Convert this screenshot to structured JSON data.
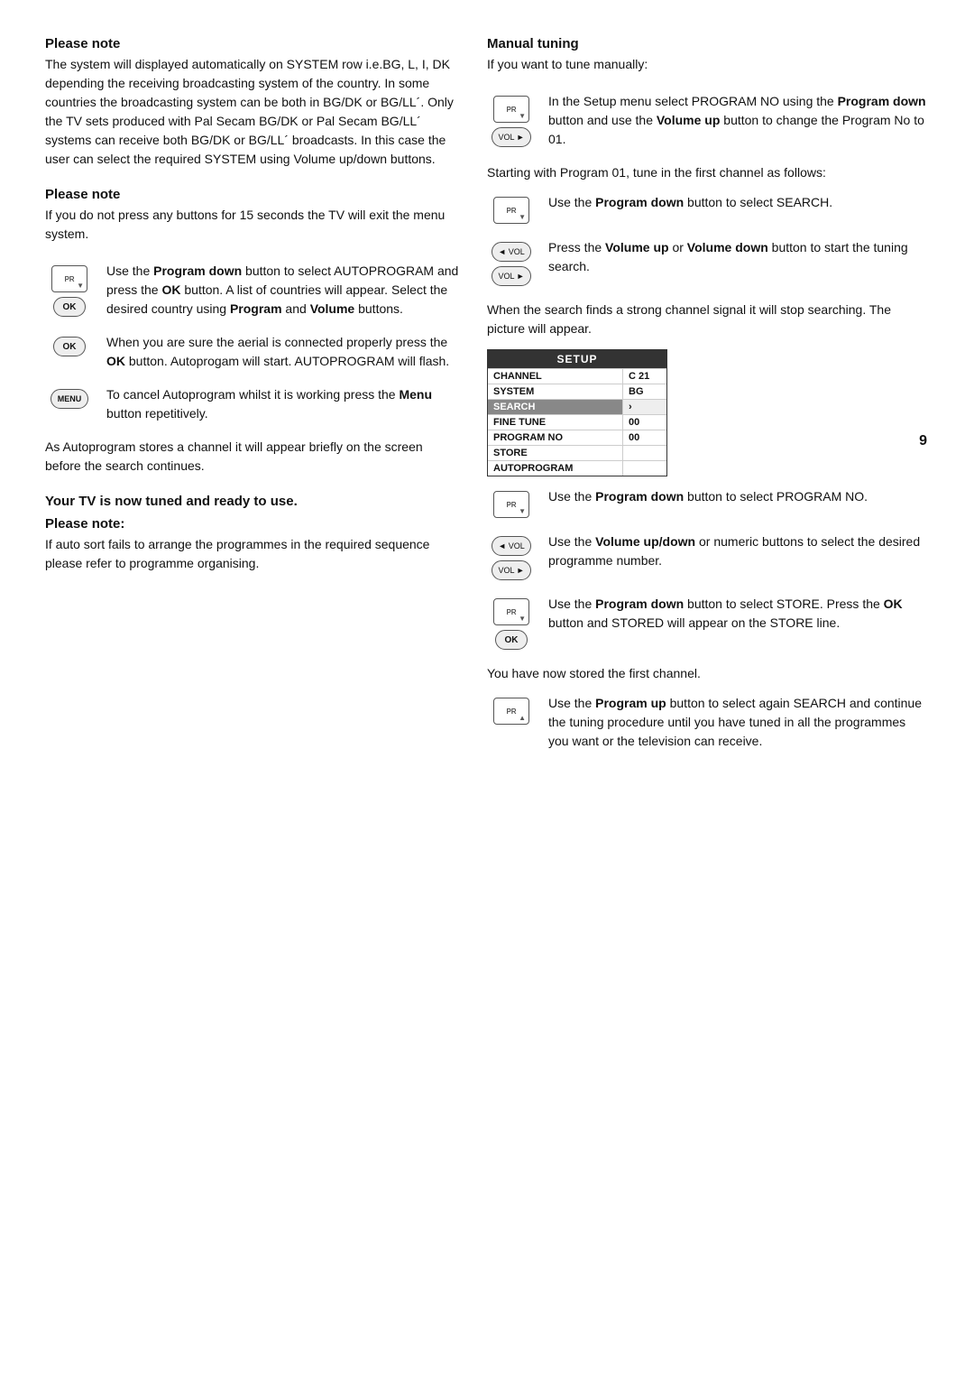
{
  "page": {
    "number": "9"
  },
  "left": {
    "please_note_1_title": "Please note",
    "please_note_1_body": "The system will displayed automatically on SYSTEM row i.e.BG, L, I, DK depending the receiving broadcasting system of the country. In some countries the broadcasting system can be both in BG/DK or BG/LL´. Only the TV sets produced with Pal Secam BG/DK or Pal Secam BG/LL´ systems can receive both BG/DK or BG/LL´ broadcasts. In this case the user can select the required SYSTEM using Volume up/down buttons.",
    "please_note_2_title": "Please note",
    "please_note_2_body": "If you do not press any buttons for 15 seconds the TV will exit the menu system.",
    "icon_row_1_text": "Use the Program down  button to select AUTOPROGRAM and press the OK button.  A list of countries will appear.  Select the desired country using Program and Volume  buttons.",
    "icon_row_2_text": "When you are sure the aerial is connected properly press the  OK button. Autoprogam will start. AUTOPROGRAM will flash.",
    "icon_row_3_text": "To cancel Autoprogram whilst it is working press the Menu button repetitively.",
    "icon_row_4_text": "As Autoprogram stores a channel it will appear briefly on the screen before the search continues.",
    "tuned_text": "Your TV is now tuned and ready to use.",
    "please_note_3_title": "Please note:",
    "please_note_3_body": "If auto sort fails to arrange the programmes in the required sequence please refer to programme organising."
  },
  "right": {
    "manual_tuning_title": "Manual  tuning",
    "manual_tuning_intro": "If you want to tune manually:",
    "block_1_text": "In the Setup menu select PROGRAM NO using the Program down  button and use the Volume up button to change the Program No to 01.",
    "block_2_text": "Starting with Program 01, tune in the first channel as follows:",
    "block_3_text": "Use the Program down  button  to select SEARCH.",
    "block_4_text": "Press the Volume up  or Volume down  button to start the tuning search.",
    "block_5_text": "When the search finds a strong channel signal it will stop searching. The picture will appear.",
    "setup_table": {
      "header": "SETUP",
      "rows": [
        {
          "label": "CHANNEL",
          "value": "C 21",
          "highlight": false
        },
        {
          "label": "SYSTEM",
          "value": "BG",
          "highlight": false
        },
        {
          "label": "SEARCH",
          "value": "›",
          "highlight": true
        },
        {
          "label": "FINE TUNE",
          "value": "00",
          "highlight": false
        },
        {
          "label": "PROGRAM NO",
          "value": "00",
          "highlight": false
        },
        {
          "label": "STORE",
          "value": "",
          "highlight": false
        },
        {
          "label": "AUTOPROGRAM",
          "value": "",
          "highlight": false
        }
      ]
    },
    "block_6_text": "Use the Program down  button to select PROGRAM NO.",
    "block_7_text": "Use the Volume up/down  or numeric buttons to select the desired programme number.",
    "block_8_text": "Use the Program down  button to select STORE. Press the OK button and STORED will appear on the STORE line.",
    "block_9_text": "You have now stored the first channel.",
    "block_10_text": "Use the  Program up  button to select again SEARCH and continue the tuning procedure until you have tuned in all the programmes you want or the television can receive."
  },
  "buttons": {
    "pr": "PR",
    "ok": "OK",
    "menu": "MENU",
    "vol_left": "◄ VOL",
    "vol_right": "VOL ►",
    "down_arrow": "▼",
    "up_arrow": "▲"
  }
}
